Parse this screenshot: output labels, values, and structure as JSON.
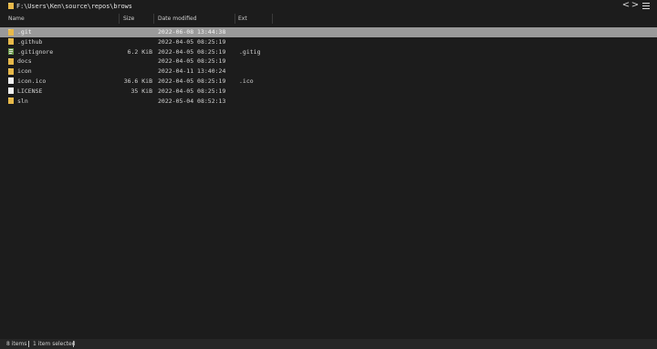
{
  "titlebar": {
    "path": "F:\\Users\\Ken\\source\\repos\\brows",
    "back_label": "<",
    "forward_label": ">"
  },
  "columns": {
    "name": "Name",
    "size": "Size",
    "date": "Date modified",
    "ext": "Ext"
  },
  "files": [
    {
      "name": ".git",
      "size": "",
      "date": "2022-06-08 13:44:38",
      "ext": "",
      "icon": "folder-icon",
      "selected": true
    },
    {
      "name": ".github",
      "size": "",
      "date": "2022-04-05 08:25:19",
      "ext": "",
      "icon": "folder-icon",
      "selected": false
    },
    {
      "name": ".gitignore",
      "size": "6.2 KiB",
      "date": "2022-04-05 08:25:19",
      "ext": ".gitig",
      "icon": "gitignore-file-icon",
      "selected": false
    },
    {
      "name": "docs",
      "size": "",
      "date": "2022-04-05 08:25:19",
      "ext": "",
      "icon": "folder-icon",
      "selected": false
    },
    {
      "name": "icon",
      "size": "",
      "date": "2022-04-11 13:40:24",
      "ext": "",
      "icon": "folder-icon",
      "selected": false
    },
    {
      "name": "icon.ico",
      "size": "36.6 KiB",
      "date": "2022-04-05 08:25:19",
      "ext": ".ico",
      "icon": "file-icon",
      "selected": false
    },
    {
      "name": "LICENSE",
      "size": "35 KiB",
      "date": "2022-04-05 08:25:19",
      "ext": "",
      "icon": "file-icon",
      "selected": false
    },
    {
      "name": "sln",
      "size": "",
      "date": "2022-05-04 08:52:13",
      "ext": "",
      "icon": "folder-icon",
      "selected": false
    }
  ],
  "status": {
    "items": "8 items",
    "selected": "1 item selected"
  },
  "colors": {
    "background": "#1c1c1c",
    "selection": "#9a9a9a",
    "folder": "#e8b94a",
    "status_bg": "#262626"
  }
}
